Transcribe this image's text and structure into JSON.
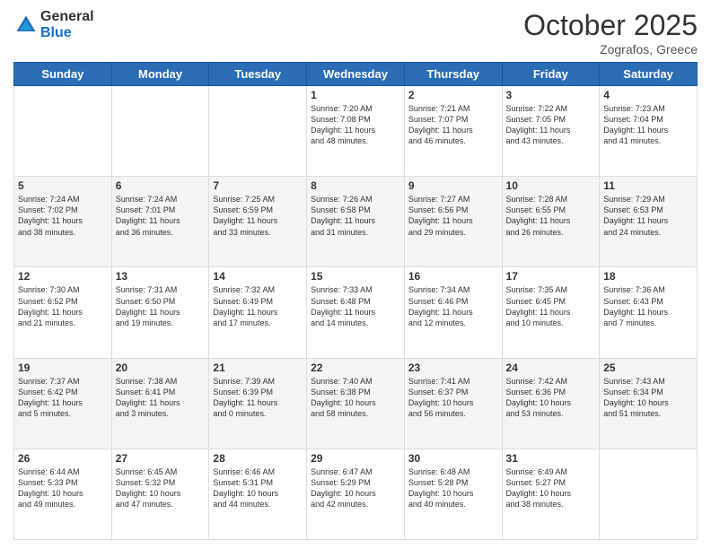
{
  "logo": {
    "general": "General",
    "blue": "Blue"
  },
  "header": {
    "month": "October 2025",
    "location": "Zografos, Greece"
  },
  "weekdays": [
    "Sunday",
    "Monday",
    "Tuesday",
    "Wednesday",
    "Thursday",
    "Friday",
    "Saturday"
  ],
  "weeks": [
    [
      {
        "day": "",
        "info": ""
      },
      {
        "day": "",
        "info": ""
      },
      {
        "day": "",
        "info": ""
      },
      {
        "day": "1",
        "info": "Sunrise: 7:20 AM\nSunset: 7:08 PM\nDaylight: 11 hours\nand 48 minutes."
      },
      {
        "day": "2",
        "info": "Sunrise: 7:21 AM\nSunset: 7:07 PM\nDaylight: 11 hours\nand 46 minutes."
      },
      {
        "day": "3",
        "info": "Sunrise: 7:22 AM\nSunset: 7:05 PM\nDaylight: 11 hours\nand 43 minutes."
      },
      {
        "day": "4",
        "info": "Sunrise: 7:23 AM\nSunset: 7:04 PM\nDaylight: 11 hours\nand 41 minutes."
      }
    ],
    [
      {
        "day": "5",
        "info": "Sunrise: 7:24 AM\nSunset: 7:02 PM\nDaylight: 11 hours\nand 38 minutes."
      },
      {
        "day": "6",
        "info": "Sunrise: 7:24 AM\nSunset: 7:01 PM\nDaylight: 11 hours\nand 36 minutes."
      },
      {
        "day": "7",
        "info": "Sunrise: 7:25 AM\nSunset: 6:59 PM\nDaylight: 11 hours\nand 33 minutes."
      },
      {
        "day": "8",
        "info": "Sunrise: 7:26 AM\nSunset: 6:58 PM\nDaylight: 11 hours\nand 31 minutes."
      },
      {
        "day": "9",
        "info": "Sunrise: 7:27 AM\nSunset: 6:56 PM\nDaylight: 11 hours\nand 29 minutes."
      },
      {
        "day": "10",
        "info": "Sunrise: 7:28 AM\nSunset: 6:55 PM\nDaylight: 11 hours\nand 26 minutes."
      },
      {
        "day": "11",
        "info": "Sunrise: 7:29 AM\nSunset: 6:53 PM\nDaylight: 11 hours\nand 24 minutes."
      }
    ],
    [
      {
        "day": "12",
        "info": "Sunrise: 7:30 AM\nSunset: 6:52 PM\nDaylight: 11 hours\nand 21 minutes."
      },
      {
        "day": "13",
        "info": "Sunrise: 7:31 AM\nSunset: 6:50 PM\nDaylight: 11 hours\nand 19 minutes."
      },
      {
        "day": "14",
        "info": "Sunrise: 7:32 AM\nSunset: 6:49 PM\nDaylight: 11 hours\nand 17 minutes."
      },
      {
        "day": "15",
        "info": "Sunrise: 7:33 AM\nSunset: 6:48 PM\nDaylight: 11 hours\nand 14 minutes."
      },
      {
        "day": "16",
        "info": "Sunrise: 7:34 AM\nSunset: 6:46 PM\nDaylight: 11 hours\nand 12 minutes."
      },
      {
        "day": "17",
        "info": "Sunrise: 7:35 AM\nSunset: 6:45 PM\nDaylight: 11 hours\nand 10 minutes."
      },
      {
        "day": "18",
        "info": "Sunrise: 7:36 AM\nSunset: 6:43 PM\nDaylight: 11 hours\nand 7 minutes."
      }
    ],
    [
      {
        "day": "19",
        "info": "Sunrise: 7:37 AM\nSunset: 6:42 PM\nDaylight: 11 hours\nand 5 minutes."
      },
      {
        "day": "20",
        "info": "Sunrise: 7:38 AM\nSunset: 6:41 PM\nDaylight: 11 hours\nand 3 minutes."
      },
      {
        "day": "21",
        "info": "Sunrise: 7:39 AM\nSunset: 6:39 PM\nDaylight: 11 hours\nand 0 minutes."
      },
      {
        "day": "22",
        "info": "Sunrise: 7:40 AM\nSunset: 6:38 PM\nDaylight: 10 hours\nand 58 minutes."
      },
      {
        "day": "23",
        "info": "Sunrise: 7:41 AM\nSunset: 6:37 PM\nDaylight: 10 hours\nand 56 minutes."
      },
      {
        "day": "24",
        "info": "Sunrise: 7:42 AM\nSunset: 6:36 PM\nDaylight: 10 hours\nand 53 minutes."
      },
      {
        "day": "25",
        "info": "Sunrise: 7:43 AM\nSunset: 6:34 PM\nDaylight: 10 hours\nand 51 minutes."
      }
    ],
    [
      {
        "day": "26",
        "info": "Sunrise: 6:44 AM\nSunset: 5:33 PM\nDaylight: 10 hours\nand 49 minutes."
      },
      {
        "day": "27",
        "info": "Sunrise: 6:45 AM\nSunset: 5:32 PM\nDaylight: 10 hours\nand 47 minutes."
      },
      {
        "day": "28",
        "info": "Sunrise: 6:46 AM\nSunset: 5:31 PM\nDaylight: 10 hours\nand 44 minutes."
      },
      {
        "day": "29",
        "info": "Sunrise: 6:47 AM\nSunset: 5:29 PM\nDaylight: 10 hours\nand 42 minutes."
      },
      {
        "day": "30",
        "info": "Sunrise: 6:48 AM\nSunset: 5:28 PM\nDaylight: 10 hours\nand 40 minutes."
      },
      {
        "day": "31",
        "info": "Sunrise: 6:49 AM\nSunset: 5:27 PM\nDaylight: 10 hours\nand 38 minutes."
      },
      {
        "day": "",
        "info": ""
      }
    ]
  ]
}
